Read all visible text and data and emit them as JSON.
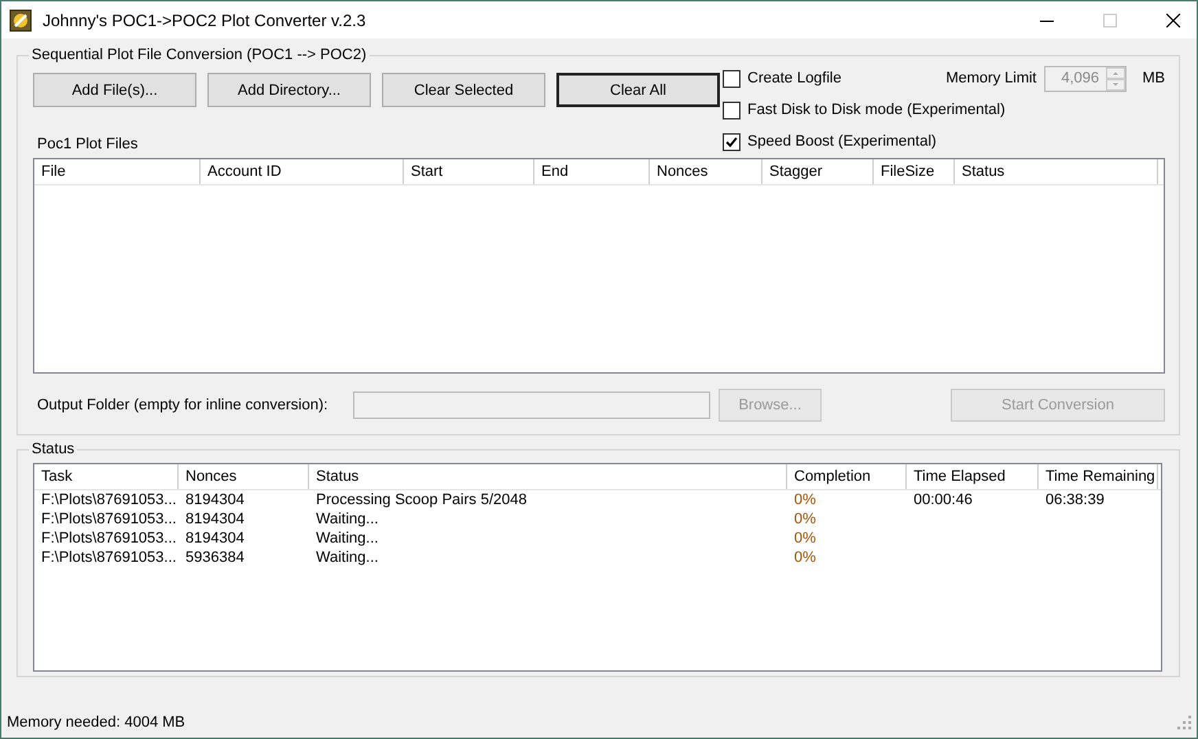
{
  "window": {
    "title": "Johnny's POC1->POC2 Plot Converter v.2.3"
  },
  "conversion_group": {
    "title": "Sequential Plot File Conversion (POC1 --> POC2)",
    "buttons": [
      {
        "label": "Add File(s)...",
        "default": false
      },
      {
        "label": "Add Directory...",
        "default": false
      },
      {
        "label": "Clear Selected",
        "default": false
      },
      {
        "label": "Clear All",
        "default": true
      }
    ],
    "options": [
      {
        "label": "Create Logfile",
        "checked": false
      },
      {
        "label": "Fast Disk to Disk mode (Experimental)",
        "checked": false
      },
      {
        "label": "Speed Boost (Experimental)",
        "checked": true
      }
    ],
    "memory_limit": {
      "label": "Memory Limit",
      "value": "4,096",
      "unit": "MB",
      "disabled": true
    },
    "files_label": "Poc1 Plot Files",
    "files_table": {
      "columns": [
        "File",
        "Account ID",
        "Start",
        "End",
        "Nonces",
        "Stagger",
        "FileSize",
        "Status"
      ]
    },
    "output_folder": {
      "label": "Output Folder (empty for inline conversion):",
      "disabled": true
    },
    "browse_button": {
      "label": "Browse...",
      "disabled": true
    },
    "start_button": {
      "label": "Start Conversion",
      "disabled": true
    }
  },
  "status_group": {
    "title": "Status",
    "table": {
      "columns": [
        "Task",
        "Nonces",
        "Status",
        "Completion",
        "Time Elapsed",
        "Time Remaining"
      ],
      "rows": [
        [
          "F:\\Plots\\87691053...",
          "8194304",
          "Processing Scoop Pairs 5/2048",
          "0%",
          "00:00:46",
          "06:38:39"
        ],
        [
          "F:\\Plots\\87691053...",
          "8194304",
          "Waiting...",
          "0%",
          "",
          ""
        ],
        [
          "F:\\Plots\\87691053...",
          "8194304",
          "Waiting...",
          "0%",
          "",
          ""
        ],
        [
          "F:\\Plots\\87691053...",
          "5936384",
          "Waiting...",
          "0%",
          "",
          ""
        ]
      ]
    }
  },
  "status_bar": "Memory needed: 4004 MB"
}
